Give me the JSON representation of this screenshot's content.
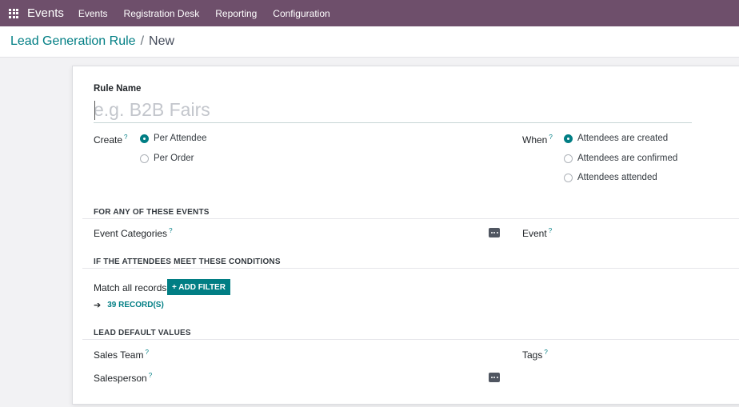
{
  "navbar": {
    "app_name": "Events",
    "menu": [
      "Events",
      "Registration Desk",
      "Reporting",
      "Configuration"
    ]
  },
  "breadcrumb": {
    "parent": "Lead Generation Rule",
    "separator": "/",
    "current": "New"
  },
  "form": {
    "rule_name_label": "Rule Name",
    "rule_name_placeholder": "e.g. B2B Fairs",
    "create_label": "Create",
    "create_options": [
      "Per Attendee",
      "Per Order"
    ],
    "create_selected": "Per Attendee",
    "when_label": "When",
    "when_options": [
      "Attendees are created",
      "Attendees are confirmed",
      "Attendees attended"
    ],
    "when_selected": "Attendees are created",
    "help_mark": "?",
    "section_events": "FOR ANY OF THESE EVENTS",
    "event_categories_label": "Event Categories",
    "event_label": "Event",
    "section_conditions": "IF THE ATTENDEES MEET THESE CONDITIONS",
    "match_text": "Match all records",
    "add_filter_label": "+ ADD FILTER",
    "records_label": "39 RECORD(S)",
    "section_defaults": "LEAD DEFAULT VALUES",
    "sales_team_label": "Sales Team",
    "tags_label": "Tags",
    "salesperson_label": "Salesperson"
  },
  "colors": {
    "navbar": "#6e4f6b",
    "accent": "#017e84"
  }
}
